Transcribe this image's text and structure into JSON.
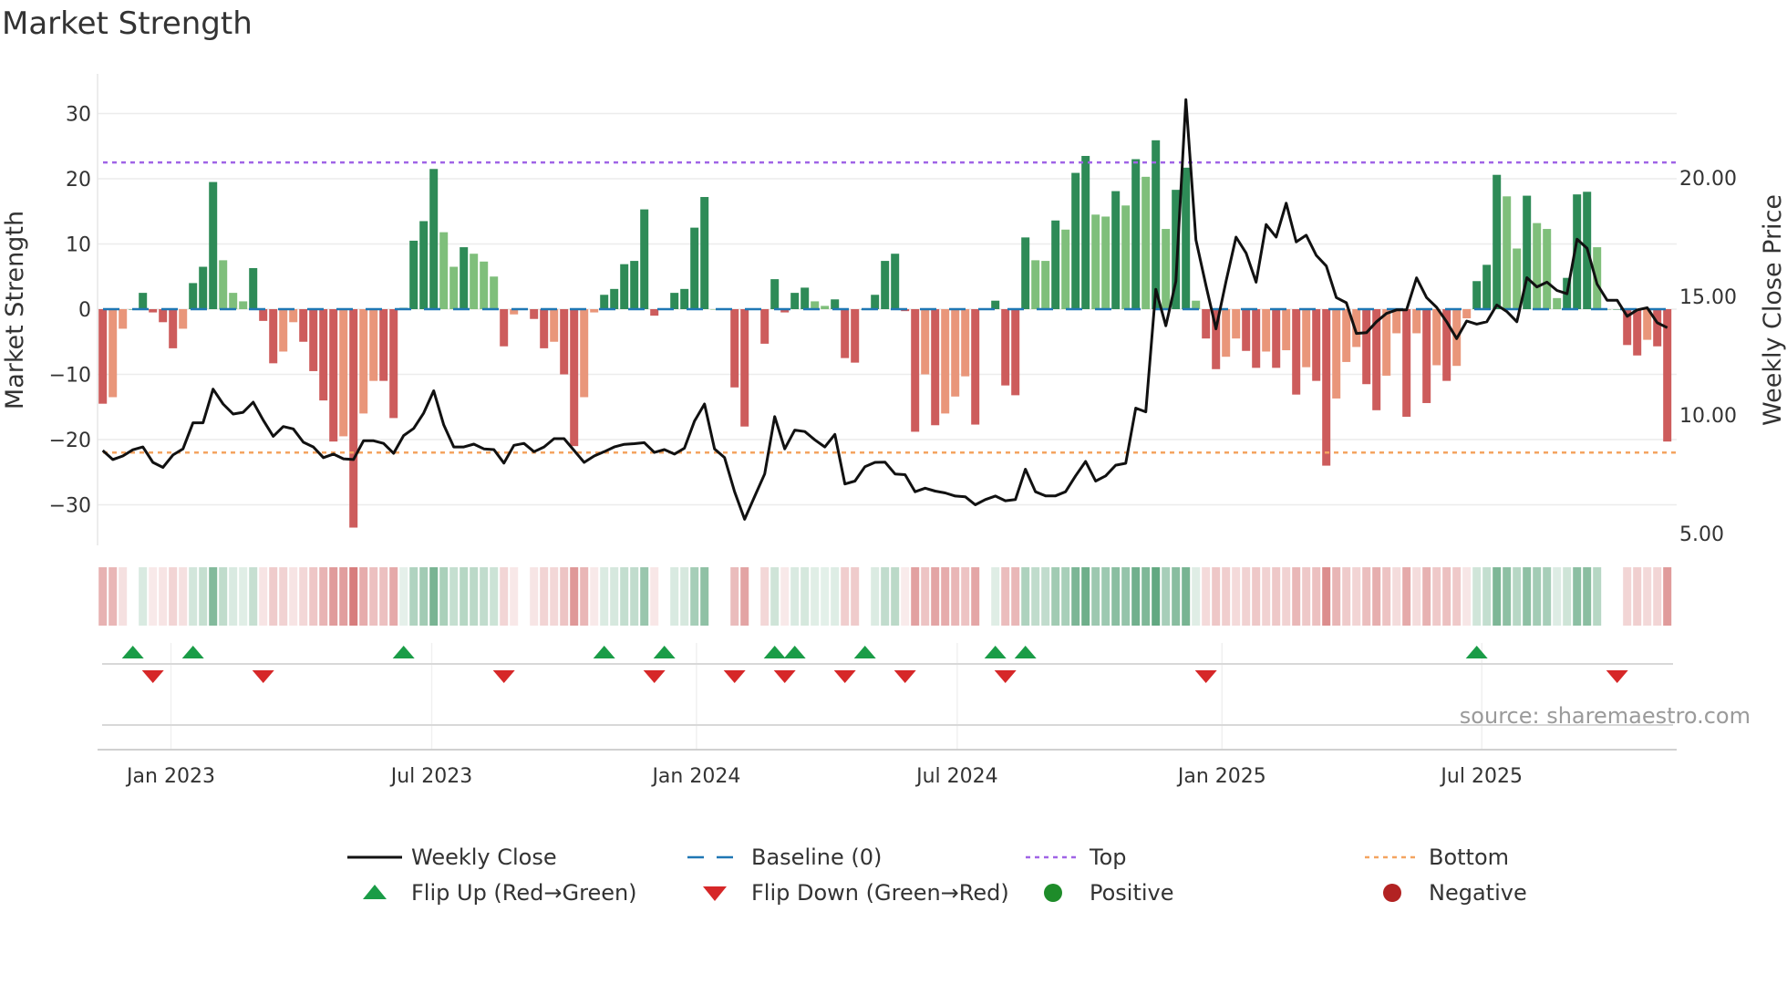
{
  "chart_data": {
    "type": "bar",
    "title": "Market Strength",
    "ylabel": "Market Strength",
    "y2label": "Weekly Close Price",
    "ylim": [
      -36,
      36
    ],
    "y2lim": [
      4.4,
      25.4
    ],
    "yticks": [
      30,
      20,
      10,
      0,
      -10,
      -20,
      -30
    ],
    "yticks_labels": [
      "30",
      "20",
      "10",
      "0",
      "−10",
      "−20",
      "−30"
    ],
    "y2ticks": [
      20,
      15,
      10,
      5
    ],
    "y2ticks_labels": [
      "20.00",
      "15.00",
      "10.00",
      "5.00"
    ],
    "grid": true,
    "top_level": 22.5,
    "bottom_level": -22,
    "baseline": 0,
    "x_unit": "week index",
    "x_ticks": [
      {
        "label": "Jan 2023",
        "week": 7.8
      },
      {
        "label": "Jul 2023",
        "week": 33.8
      },
      {
        "label": "Jan 2024",
        "week": 60.2
      },
      {
        "label": "Jul 2024",
        "week": 86.2
      },
      {
        "label": "Jan 2025",
        "week": 112.6
      },
      {
        "label": "Jul 2025",
        "week": 138.5
      }
    ],
    "strength": [
      -14.5,
      -13.5,
      -3,
      0,
      2.5,
      -0.5,
      -2,
      -6,
      -3,
      4,
      6.5,
      19.5,
      7.5,
      2.5,
      1.2,
      6.3,
      -1.8,
      -8.3,
      -6.5,
      -2,
      -5,
      -9.5,
      -14,
      -20.3,
      -19.5,
      -33.5,
      -16,
      -11,
      -11,
      -16.7,
      0.2,
      10.5,
      13.5,
      21.5,
      11.8,
      6.5,
      9.5,
      8.5,
      7.3,
      5,
      -5.7,
      -0.8,
      0,
      -1.5,
      -6,
      -5,
      -10,
      -21,
      -13.5,
      -0.5,
      2.2,
      3.1,
      6.9,
      7.4,
      15.3,
      -1,
      0,
      2.5,
      3.1,
      12.5,
      17.2,
      0,
      0,
      -12,
      -18,
      0,
      -5.3,
      4.6,
      -0.5,
      2.5,
      3.3,
      1.2,
      0.5,
      1.5,
      -7.5,
      -8.2,
      0,
      2.2,
      7.4,
      8.5,
      -0.3,
      -18.8,
      -10,
      -17.8,
      -16,
      -13.4,
      -10.3,
      -17.7,
      0,
      1.3,
      -11.7,
      -13.2,
      11,
      7.5,
      7.4,
      13.6,
      12.2,
      20.9,
      23.5,
      14.5,
      14.2,
      18.1,
      15.9,
      23,
      20.3,
      25.9,
      12.3,
      18.3,
      21.7,
      1.3,
      -4.5,
      -9.2,
      -7.3,
      -4.5,
      -6.4,
      -9,
      -6.5,
      -9,
      -6.3,
      -13.1,
      -8.9,
      -11,
      -24,
      -13.7,
      -8.1,
      -5.8,
      -11.5,
      -15.5,
      -10.2,
      -3.7,
      -16.5,
      -3.7,
      -14.4,
      -8.6,
      -11,
      -8.7,
      -1.4,
      4.3,
      6.8,
      20.6,
      17.3,
      9.3,
      17.4,
      13.2,
      12.3,
      1.7,
      4.8,
      17.6,
      18,
      9.5,
      0,
      0,
      -5.5,
      -7.1,
      -4.7,
      -5.7,
      -20.3
    ],
    "weekly_close": [
      8.5,
      8.12,
      8.27,
      8.53,
      8.65,
      8.0,
      7.79,
      8.31,
      8.57,
      9.67,
      9.67,
      11.09,
      10.46,
      10.04,
      10.11,
      10.54,
      9.78,
      9.1,
      9.51,
      9.41,
      8.85,
      8.65,
      8.2,
      8.35,
      8.15,
      8.12,
      8.91,
      8.91,
      8.8,
      8.38,
      9.13,
      9.43,
      10.08,
      11.02,
      9.58,
      8.65,
      8.65,
      8.77,
      8.57,
      8.54,
      7.97,
      8.72,
      8.8,
      8.45,
      8.65,
      9.0,
      9.0,
      8.5,
      8.0,
      8.27,
      8.45,
      8.65,
      8.76,
      8.79,
      8.83,
      8.42,
      8.54,
      8.35,
      8.6,
      9.74,
      10.46,
      8.57,
      8.2,
      6.76,
      5.6,
      6.56,
      7.51,
      9.93,
      8.57,
      9.36,
      9.3,
      8.95,
      8.65,
      9.18,
      7.09,
      7.21,
      7.82,
      8.0,
      8.01,
      7.51,
      7.48,
      6.76,
      6.91,
      6.79,
      6.71,
      6.58,
      6.55,
      6.21,
      6.43,
      6.58,
      6.38,
      6.43,
      7.71,
      6.76,
      6.59,
      6.59,
      6.76,
      7.43,
      8.04,
      7.21,
      7.43,
      7.88,
      7.96,
      10.29,
      10.13,
      15.3,
      13.76,
      15.63,
      23.3,
      17.38,
      15.46,
      13.63,
      15.63,
      17.5,
      16.83,
      15.6,
      18.03,
      17.5,
      18.93,
      17.3,
      17.58,
      16.73,
      16.28,
      14.95,
      14.73,
      13.44,
      13.47,
      13.93,
      14.28,
      14.43,
      14.43,
      15.78,
      14.95,
      14.54,
      13.93,
      13.22,
      13.96,
      13.83,
      13.93,
      14.64,
      14.36,
      13.93,
      15.79,
      15.4,
      15.6,
      15.25,
      15.11,
      17.41,
      17.03,
      15.52,
      14.84,
      14.84,
      14.16,
      14.43,
      14.52,
      13.89,
      13.68
    ],
    "flip_up_weeks": [
      4,
      10,
      31,
      51,
      57,
      68,
      70,
      77,
      90,
      93,
      138
    ],
    "flip_down_weeks": [
      6,
      17,
      41,
      56,
      64,
      69,
      75,
      81,
      91,
      111,
      152
    ],
    "legend_position": "bottom",
    "legend": [
      {
        "key": "close",
        "label": "Weekly Close"
      },
      {
        "key": "baseline",
        "label": "Baseline (0)"
      },
      {
        "key": "top",
        "label": "Top"
      },
      {
        "key": "bottom",
        "label": "Bottom"
      },
      {
        "key": "flip_up",
        "label": "Flip Up (Red→Green)"
      },
      {
        "key": "flip_down",
        "label": "Flip Down (Green→Red)"
      },
      {
        "key": "positive",
        "label": "Positive"
      },
      {
        "key": "negative",
        "label": "Negative"
      }
    ],
    "colors": {
      "pos_strong": "#2e8b57",
      "pos_weak": "#7fbf7b",
      "neg_strong": "#cd5c5c",
      "neg_weak": "#e9967a",
      "baseline": "#1f77b4",
      "top": "#a064e6",
      "bottom": "#f4a460",
      "close": "#111111",
      "flip_up": "#1a9c47",
      "flip_down": "#d62728",
      "positive": "#1e8c2a",
      "negative": "#b22222"
    },
    "source": "source: sharemaestro.com"
  }
}
